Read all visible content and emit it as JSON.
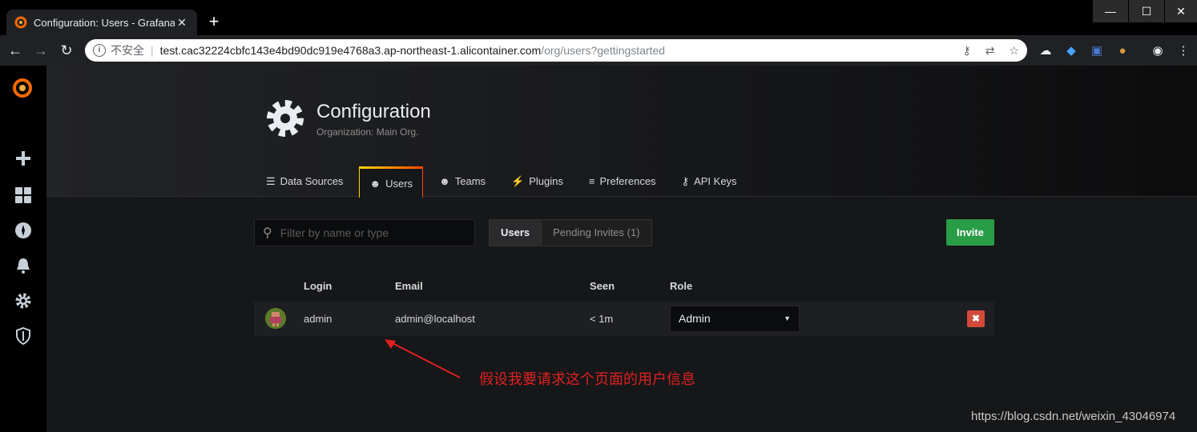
{
  "browser": {
    "tab_title": "Configuration: Users - Grafana",
    "tab_close": "✕",
    "new_tab": "+",
    "window_controls": {
      "minimize": "—",
      "maximize": "☐",
      "close": "✕"
    },
    "address": {
      "insecure_label": "不安全",
      "host": "test.cac32224cbfc143e4bd90dc919e4768a3.ap-northeast-1.alicontainer.com",
      "path": "/org/users?gettingstarted"
    }
  },
  "sidebar": {
    "items": [
      "grafana-logo",
      "create",
      "dashboards",
      "explore",
      "alerting",
      "configuration",
      "server-admin"
    ]
  },
  "header": {
    "title": "Configuration",
    "subtitle": "Organization: Main Org."
  },
  "tabs": [
    {
      "label": "Data Sources",
      "icon": "database-icon",
      "active": false
    },
    {
      "label": "Users",
      "icon": "user-icon",
      "active": true
    },
    {
      "label": "Teams",
      "icon": "users-icon",
      "active": false
    },
    {
      "label": "Plugins",
      "icon": "plug-icon",
      "active": false
    },
    {
      "label": "Preferences",
      "icon": "sliders-icon",
      "active": false
    },
    {
      "label": "API Keys",
      "icon": "key-icon",
      "active": false
    }
  ],
  "filter": {
    "placeholder": "Filter by name or type"
  },
  "segment": {
    "users": "Users",
    "pending": "Pending Invites (1)"
  },
  "invite_button": "Invite",
  "table": {
    "headers": {
      "login": "Login",
      "email": "Email",
      "seen": "Seen",
      "role": "Role"
    },
    "rows": [
      {
        "login": "admin",
        "email": "admin@localhost",
        "seen": "< 1m",
        "role": "Admin"
      }
    ]
  },
  "annotation": "假设我要请求这个页面的用户信息",
  "watermark": "https://blog.csdn.net/weixin_43046974",
  "colors": {
    "accent": "#299c46",
    "danger": "#d44a3a",
    "annotation": "#e02020"
  }
}
